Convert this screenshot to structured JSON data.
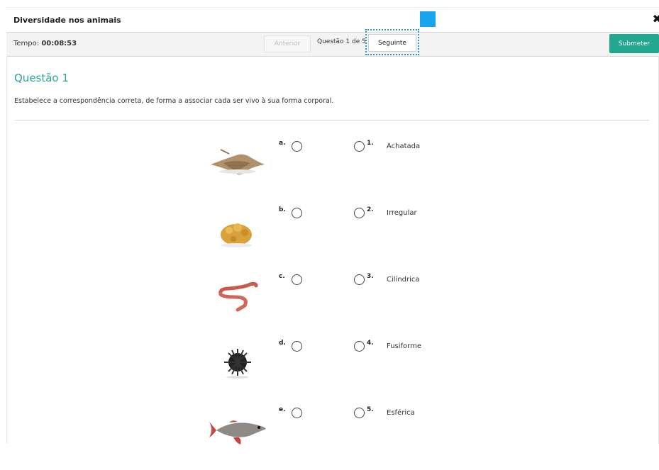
{
  "window": {
    "title": "Diversidade nos animais",
    "close_icon": "close-icon"
  },
  "toolbar": {
    "timer_label": "Tempo:",
    "timer_value": "00:08:53",
    "prev_label": "Anterior",
    "counter": "Questão 1 de 5",
    "next_label": "Seguinte",
    "submit_label": "Submeter"
  },
  "question": {
    "title": "Questão 1",
    "text": "Estabelece a correspondência correta, de forma a associar cada ser vivo à sua forma corporal."
  },
  "rows": [
    {
      "letter": "a.",
      "animal": "stingray-image",
      "number": "1.",
      "shape": "Achatada"
    },
    {
      "letter": "b.",
      "animal": "sponge-image",
      "number": "2.",
      "shape": "Irregular"
    },
    {
      "letter": "c.",
      "animal": "earthworm-image",
      "number": "3.",
      "shape": "Cilíndrica"
    },
    {
      "letter": "d.",
      "animal": "sea-urchin-image",
      "number": "4.",
      "shape": "Fusiforme"
    },
    {
      "letter": "e.",
      "animal": "fish-image",
      "number": "5.",
      "shape": "Esférica"
    }
  ],
  "colors": {
    "accent": "#2aa593",
    "submit": "#23a68f",
    "focus": "#2e96cd",
    "marker": "#18a5ee"
  }
}
